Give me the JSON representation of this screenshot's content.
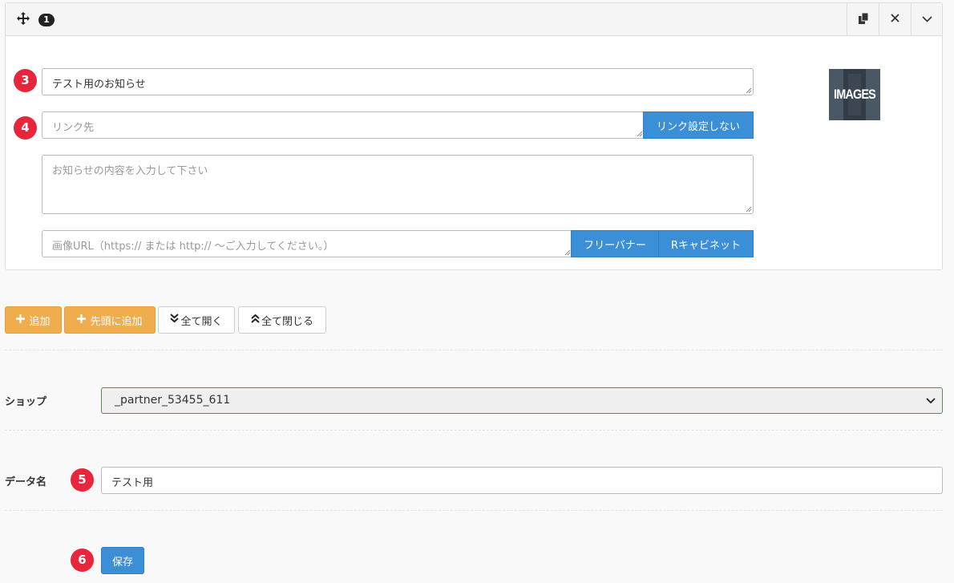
{
  "item": {
    "index": "1",
    "title_value": "テスト用のお知らせ",
    "link_placeholder": "リンク先",
    "link_button": "リンク設定しない",
    "content_placeholder": "お知らせの内容を入力して下さい",
    "image_url_placeholder": "画像URL（https:// または http:// ～ご入力してください。）",
    "free_banner_button": "フリーバナー",
    "r_cabinet_button": "Rキャビネット",
    "thumbnail_text": "IMAGES"
  },
  "toolbar": {
    "add_label": "追加",
    "add_top_label": "先頭に追加",
    "expand_all_label": "全て開く",
    "collapse_all_label": "全て閉じる"
  },
  "form": {
    "shop_label": "ショップ",
    "shop_value": "_partner_53455_611",
    "data_name_label": "データ名",
    "data_name_value": "テスト用",
    "save_label": "保存"
  },
  "annotations": {
    "title_marker": "3",
    "link_marker": "4",
    "data_name_marker": "5",
    "save_marker": "6"
  },
  "colors": {
    "primary": "#3b8fd6",
    "warning": "#f0ad4e",
    "marker_red": "#e8263b"
  }
}
